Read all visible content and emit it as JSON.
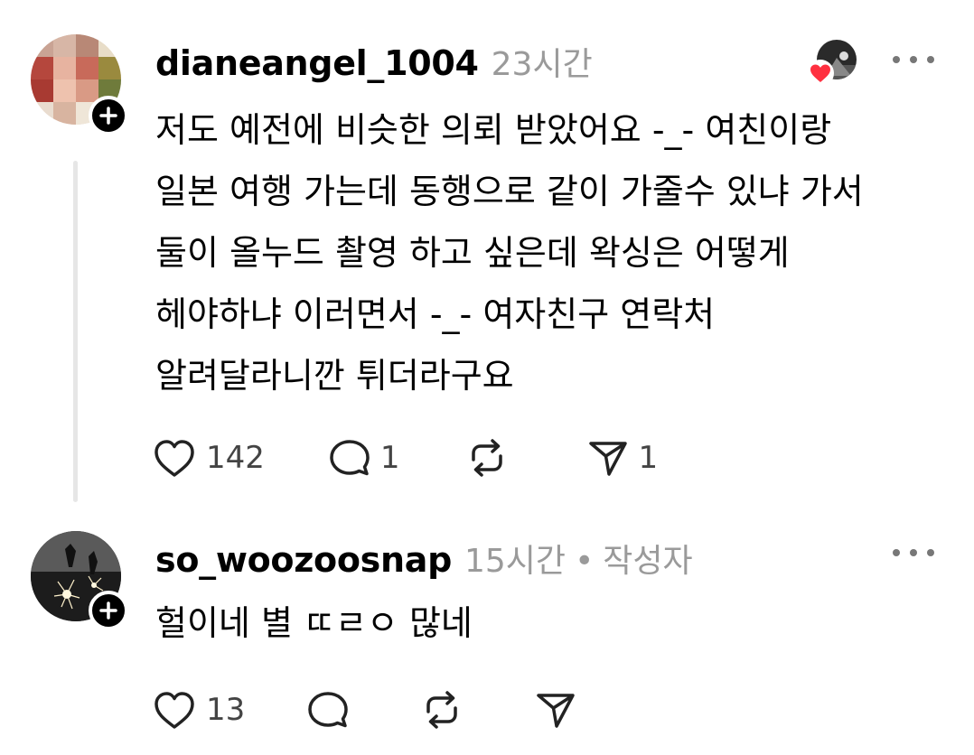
{
  "comments": [
    {
      "username": "dianeangel_1004",
      "timestamp": "23시간",
      "text": "저도 예전에 비슷한 의뢰 받았어요 -_- 여친이랑\n일본 여행 가는데 동행으로 같이 가줄수 있냐 가서\n둘이 올누드 촬영 하고 싶은데 왁싱은 어떻게\n헤야하냐 이러면서 -_- 여자친구 연락처\n알려달라니깐 튀더라구요",
      "likes": "142",
      "replies": "1",
      "reposts": "",
      "shares": "1",
      "liked_by_author": true
    },
    {
      "username": "so_woozoosnap",
      "timestamp": "15시간",
      "separator": "•",
      "author_tag": "작성자",
      "text": "헐이네 별 ㄸㄹㅇ 많네",
      "likes": "13",
      "replies": "",
      "reposts": "",
      "shares": ""
    }
  ],
  "icons": {
    "like": "heart-outline-icon",
    "reply": "speech-bubble-icon",
    "repost": "repost-arrows-icon",
    "share": "paper-plane-icon",
    "more": "ellipsis-icon",
    "follow": "plus-icon"
  },
  "colors": {
    "text": "#000000",
    "muted": "#9a9a9a",
    "heart": "#ff3040"
  }
}
